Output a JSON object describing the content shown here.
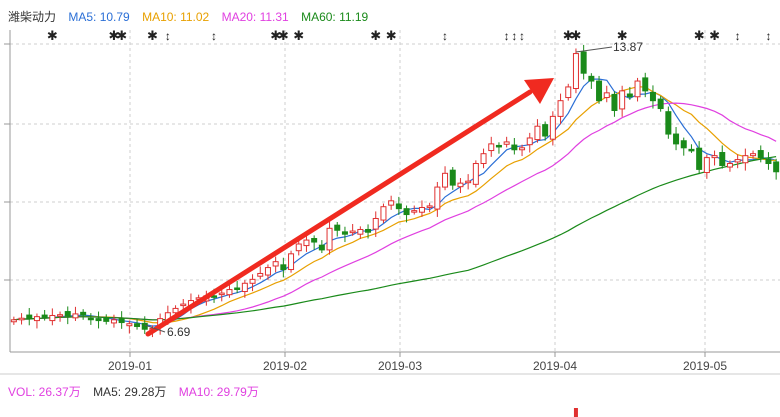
{
  "stock": {
    "name": "潍柴动力",
    "ma5_label": "MA5: 10.79",
    "ma10_label": "MA10: 11.02",
    "ma20_label": "MA20: 11.31",
    "ma60_label": "MA60: 11.19"
  },
  "volume": {
    "vol_label": "VOL: 26.37万",
    "ma5_label": "MA5: 29.28万",
    "ma10_label": "MA10: 29.79万"
  },
  "colors": {
    "up": "#e03030",
    "down": "#1a8a1a",
    "ma5": "#2b6fd6",
    "ma10": "#e8a000",
    "ma20": "#e040e0",
    "ma60": "#1a8a1a",
    "arrow": "#f02a20",
    "grid": "#cfcfcf"
  },
  "chart_data": {
    "type": "candlestick",
    "x_ticks": [
      "2019-01",
      "2019-02",
      "2019-03",
      "2019-04",
      "2019-05"
    ],
    "annotations": {
      "high": "13.87",
      "low": "6.69"
    },
    "trend_arrow": {
      "from_date": "2019-01",
      "to_date": "2019-04"
    },
    "closes": [
      7.02,
      7.06,
      7.04,
      7.1,
      7.08,
      7.13,
      7.15,
      7.11,
      7.17,
      7.14,
      7.05,
      7.0,
      6.98,
      7.02,
      6.95,
      6.92,
      6.85,
      6.78,
      6.8,
      7.05,
      7.2,
      7.31,
      7.42,
      7.51,
      7.58,
      7.63,
      7.61,
      7.7,
      7.79,
      7.82,
      7.95,
      8.05,
      8.2,
      8.35,
      8.5,
      8.3,
      8.7,
      8.95,
      9.05,
      9.0,
      8.8,
      9.35,
      9.3,
      9.2,
      9.28,
      9.32,
      9.25,
      9.6,
      9.9,
      10.05,
      9.85,
      9.7,
      9.8,
      9.88,
      9.92,
      10.4,
      10.75,
      10.45,
      10.5,
      10.55,
      11.0,
      11.25,
      11.5,
      11.45,
      11.55,
      11.35,
      11.4,
      11.65,
      11.95,
      11.7,
      12.2,
      12.6,
      12.95,
      13.8,
      13.3,
      13.1,
      12.6,
      12.8,
      12.35,
      12.85,
      12.7,
      13.1,
      12.85,
      12.6,
      12.4,
      11.75,
      11.5,
      11.4,
      11.35,
      10.85,
      11.15,
      11.2,
      10.95,
      11.0,
      11.1,
      11.2,
      11.25,
      11.15,
      11.0,
      10.79
    ],
    "ma_series": [
      "MA5",
      "MA10",
      "MA20",
      "MA60"
    ]
  }
}
